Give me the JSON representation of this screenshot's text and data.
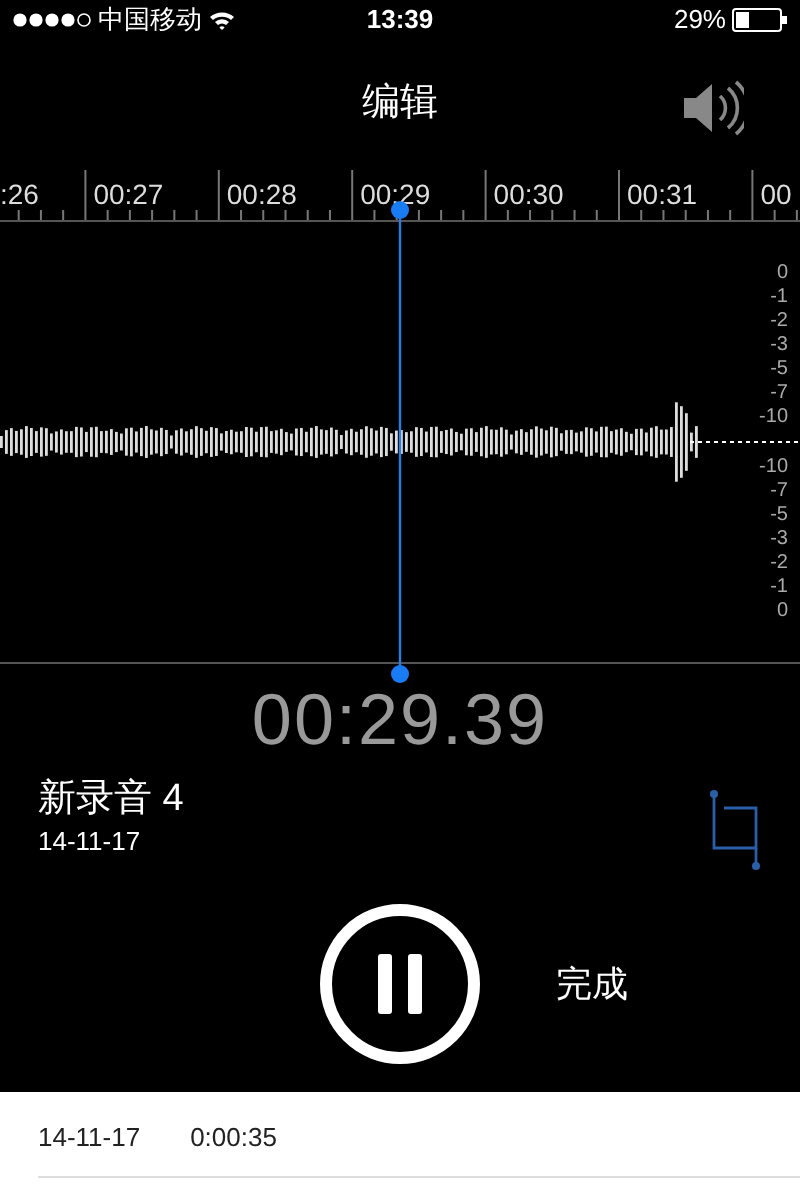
{
  "status_bar": {
    "carrier": "中国移动",
    "time": "13:39",
    "battery": "29%"
  },
  "title": "编辑",
  "timeline": {
    "labels": [
      ":26",
      "00:27",
      "00:28",
      "00:29",
      "00:30",
      "00:31",
      "00"
    ]
  },
  "db_scale": {
    "upper": [
      "0",
      "-1",
      "-2",
      "-3",
      "-5",
      "-7",
      "-10"
    ],
    "lower": [
      "-10",
      "-7",
      "-5",
      "-3",
      "-2",
      "-1",
      "0"
    ]
  },
  "elapsed": "00:29.39",
  "recording": {
    "name": "新录音 4",
    "date": "14-11-17"
  },
  "controls": {
    "playing": true,
    "done": "完成"
  },
  "list": [
    {
      "date": "14-11-17",
      "duration": "0:00:35"
    }
  ]
}
